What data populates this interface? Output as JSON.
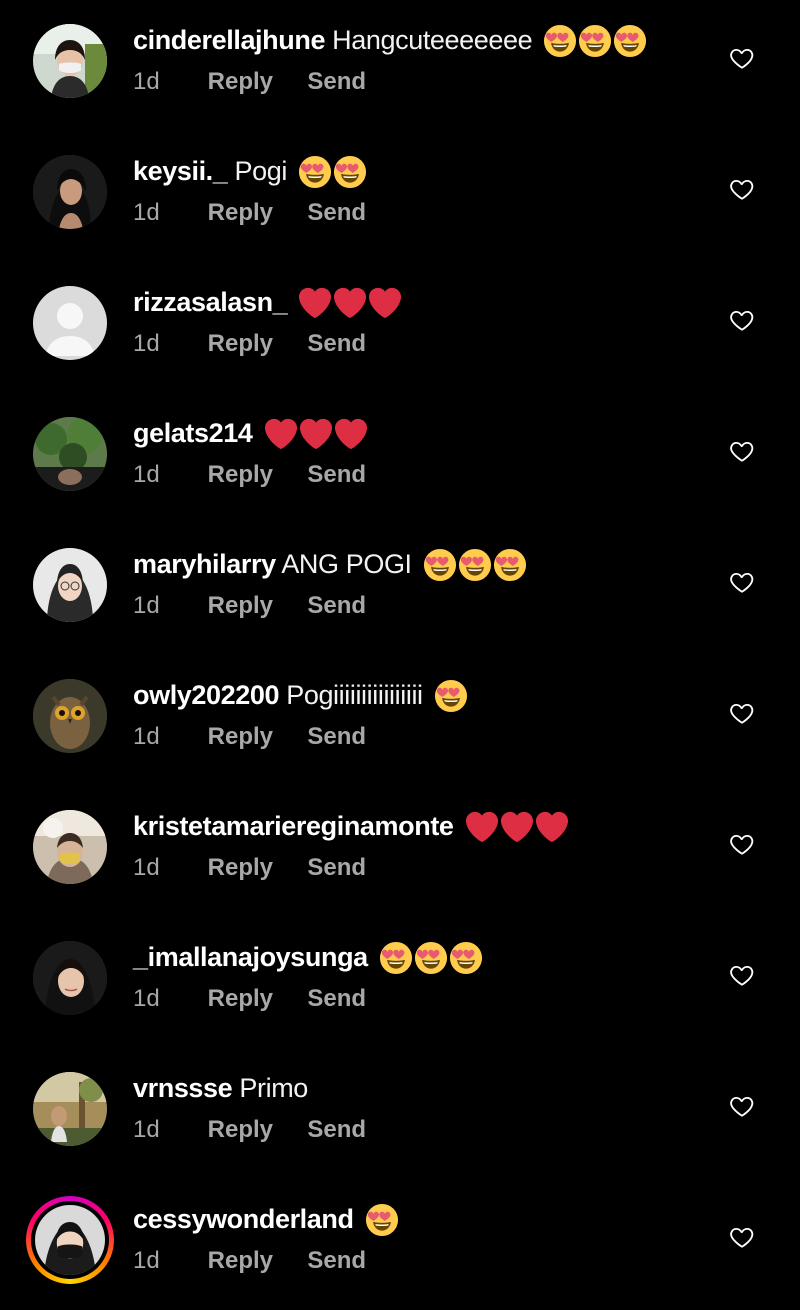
{
  "colors": {
    "background": "#000000",
    "username": "#ffffff",
    "text": "#f2f2f2",
    "meta": "#a8a8a8"
  },
  "comments": [
    {
      "username": "cinderellajhune",
      "text": "Hangcuteeeeeee",
      "emoji": [
        "heart-eyes-emoji",
        "heart-eyes-emoji",
        "heart-eyes-emoji"
      ],
      "time": "1d",
      "reply": "Reply",
      "send": "Send",
      "avatar": "photo-woman-mask",
      "like_icon": "heart-outline-icon"
    },
    {
      "username": "keysii._",
      "text": "Pogi",
      "emoji": [
        "heart-eyes-emoji",
        "heart-eyes-emoji"
      ],
      "time": "1d",
      "reply": "Reply",
      "send": "Send",
      "avatar": "photo-woman-dark-hair",
      "like_icon": "heart-outline-icon"
    },
    {
      "username": "rizzasalasn_",
      "text": "",
      "emoji": [
        "red-heart-emoji",
        "red-heart-emoji",
        "red-heart-emoji"
      ],
      "time": "1d",
      "reply": "Reply",
      "send": "Send",
      "avatar": "default-avatar",
      "like_icon": "heart-outline-icon"
    },
    {
      "username": "gelats214",
      "text": "",
      "emoji": [
        "red-heart-emoji",
        "red-heart-emoji",
        "red-heart-emoji"
      ],
      "time": "1d",
      "reply": "Reply",
      "send": "Send",
      "avatar": "photo-trees",
      "like_icon": "heart-outline-icon"
    },
    {
      "username": "maryhilarry",
      "text": "ANG POGI",
      "emoji": [
        "heart-eyes-emoji",
        "heart-eyes-emoji",
        "heart-eyes-emoji"
      ],
      "time": "1d",
      "reply": "Reply",
      "send": "Send",
      "avatar": "photo-woman-glasses",
      "like_icon": "heart-outline-icon"
    },
    {
      "username": "owly202200",
      "text": "Pogiiiiiiiiiiiiiiii",
      "emoji": [
        "heart-eyes-emoji"
      ],
      "time": "1d",
      "reply": "Reply",
      "send": "Send",
      "avatar": "photo-owl",
      "like_icon": "heart-outline-icon"
    },
    {
      "username": "kristetamarieregina​monte",
      "text": "",
      "emoji": [
        "red-heart-emoji",
        "red-heart-emoji",
        "red-heart-emoji"
      ],
      "time": "1d",
      "reply": "Reply",
      "send": "Send",
      "avatar": "photo-woman-yellow-mask",
      "like_icon": "heart-outline-icon"
    },
    {
      "username": "_imallanajoysunga",
      "text": "",
      "emoji": [
        "heart-eyes-emoji",
        "heart-eyes-emoji",
        "heart-eyes-emoji"
      ],
      "time": "1d",
      "reply": "Reply",
      "send": "Send",
      "avatar": "photo-woman-smile",
      "like_icon": "heart-outline-icon"
    },
    {
      "username": "vrnssse",
      "text": "Primo",
      "emoji": [],
      "time": "1d",
      "reply": "Reply",
      "send": "Send",
      "avatar": "photo-outdoor",
      "like_icon": "heart-outline-icon"
    },
    {
      "username": "cessywonderland",
      "text": "",
      "emoji": [
        "heart-eyes-emoji"
      ],
      "time": "1d",
      "reply": "Reply",
      "send": "Send",
      "avatar": "photo-woman-black-mask-story",
      "like_icon": "heart-outline-icon"
    }
  ]
}
